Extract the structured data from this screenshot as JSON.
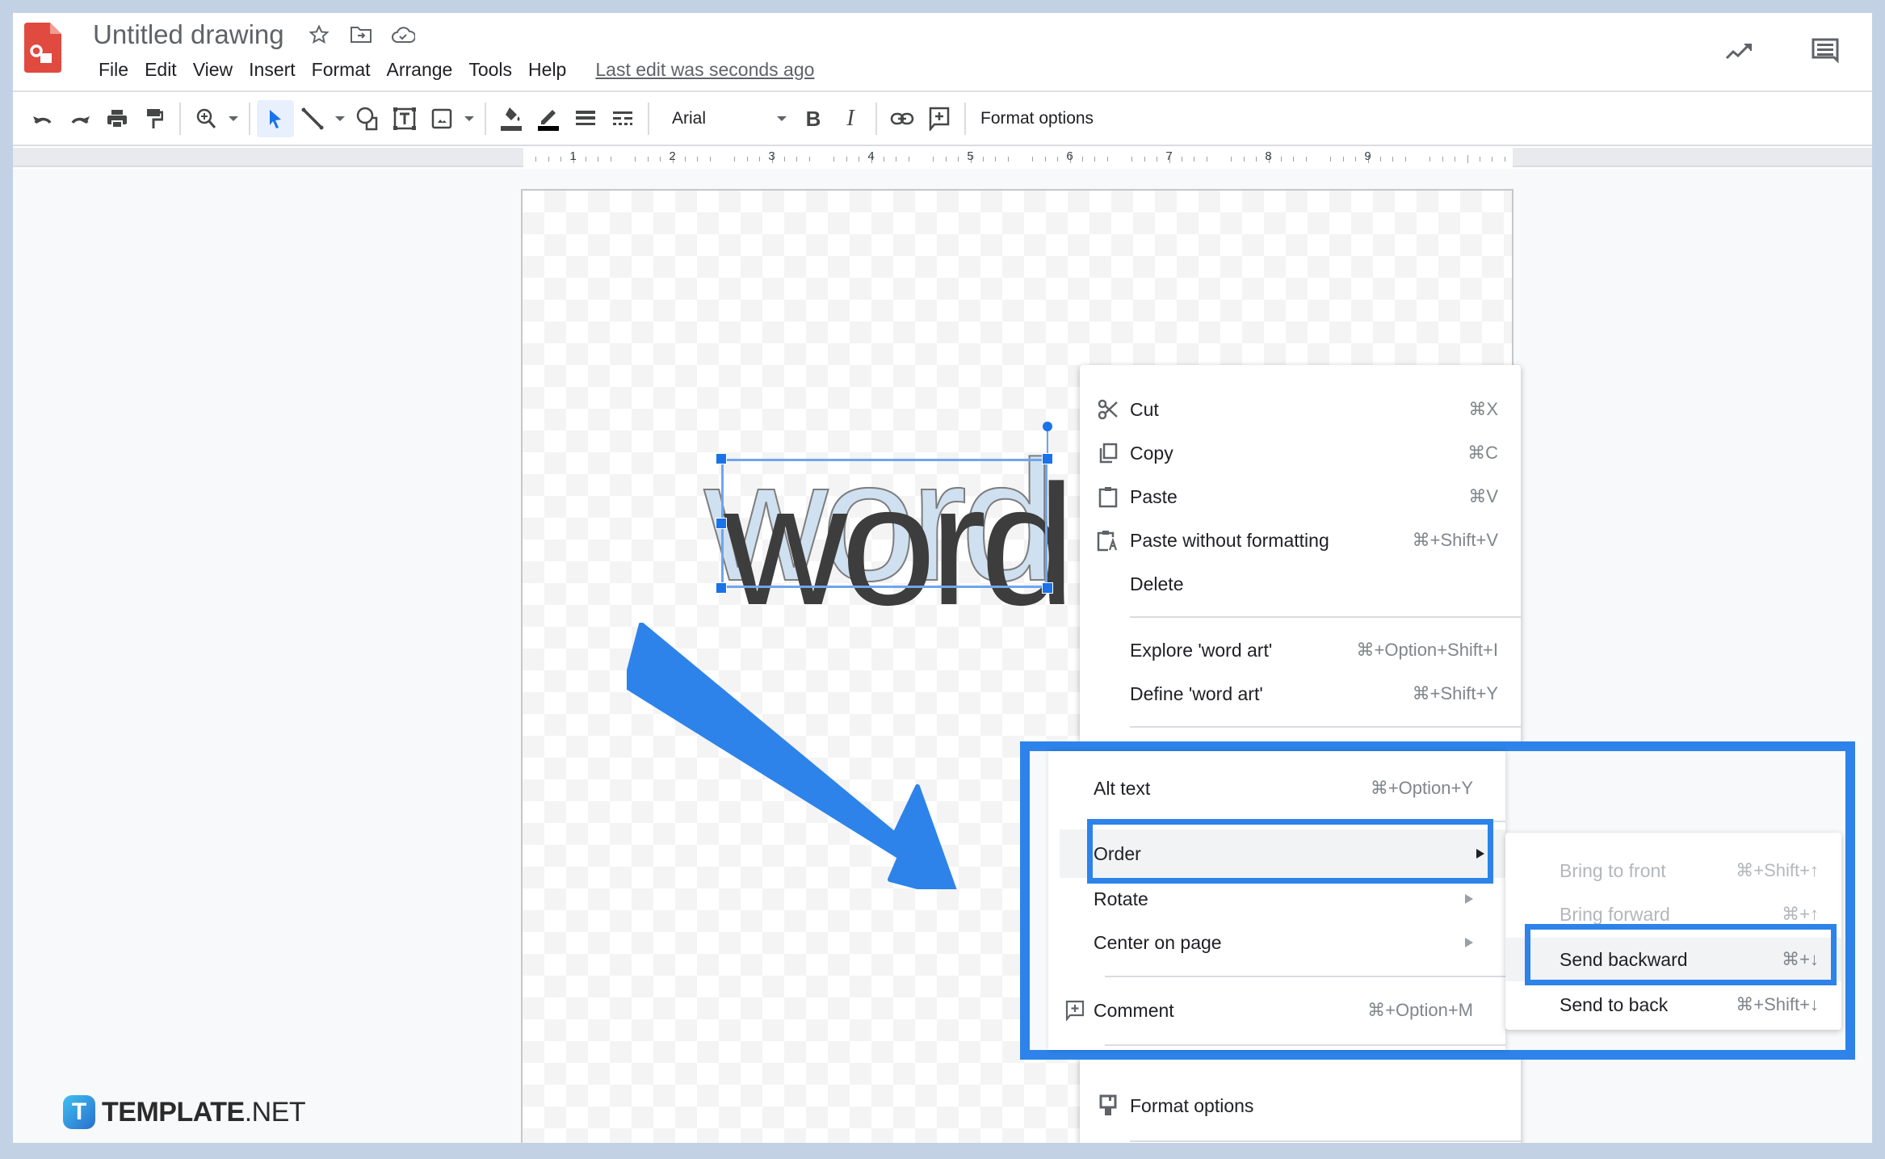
{
  "header": {
    "title": "Untitled drawing",
    "title_icons": [
      "star-icon",
      "move-to-folder-icon",
      "cloud-saved-icon"
    ],
    "menu": [
      "File",
      "Edit",
      "View",
      "Insert",
      "Format",
      "Arrange",
      "Tools",
      "Help"
    ],
    "last_edit": "Last edit was seconds ago",
    "right_icons": [
      "activity-trend-icon",
      "comments-icon"
    ]
  },
  "toolbar": {
    "font": "Arial",
    "format_options": "Format options",
    "fill_color": "#444444",
    "border_color": "#000000"
  },
  "ruler": {
    "numbers": [
      "1",
      "2",
      "3",
      "4",
      "5",
      "6",
      "7",
      "8",
      "9"
    ]
  },
  "canvas": {
    "wordart_text": "word"
  },
  "context_menu": {
    "items": [
      {
        "label": "Cut",
        "shortcut": "⌘X",
        "icon": "scissors-icon"
      },
      {
        "label": "Copy",
        "shortcut": "⌘C",
        "icon": "copy-icon"
      },
      {
        "label": "Paste",
        "shortcut": "⌘V",
        "icon": "clipboard-icon"
      },
      {
        "label": "Paste without formatting",
        "shortcut": "⌘+Shift+V",
        "icon": "clipboard-text-icon"
      },
      {
        "label": "Delete",
        "shortcut": ""
      },
      {
        "label": "Explore 'word art'",
        "shortcut": "⌘+Option+Shift+I"
      },
      {
        "label": "Define 'word art'",
        "shortcut": "⌘+Shift+Y"
      }
    ],
    "highlighted": [
      {
        "label": "Alt text",
        "shortcut": "⌘+Option+Y"
      },
      {
        "label": "Order",
        "submenu": true
      },
      {
        "label": "Rotate",
        "submenu": true
      },
      {
        "label": "Center on page",
        "submenu": true
      },
      {
        "label": "Comment",
        "shortcut": "⌘+Option+M",
        "icon": "add-comment-icon"
      }
    ],
    "format_options": "Format options"
  },
  "order_submenu": {
    "items": [
      {
        "label": "Bring to front",
        "shortcut": "⌘+Shift+↑",
        "disabled": true
      },
      {
        "label": "Bring forward",
        "shortcut": "⌘+↑",
        "disabled": true
      },
      {
        "label": "Send backward",
        "shortcut": "⌘+↓",
        "disabled": false
      },
      {
        "label": "Send to back",
        "shortcut": "⌘+Shift+↓",
        "disabled": false
      }
    ]
  },
  "annotation": {
    "highlight_color": "#2d83e9"
  },
  "watermark": {
    "badge": "T",
    "brand": "TEMPLATE",
    "suffix": ".NET"
  }
}
